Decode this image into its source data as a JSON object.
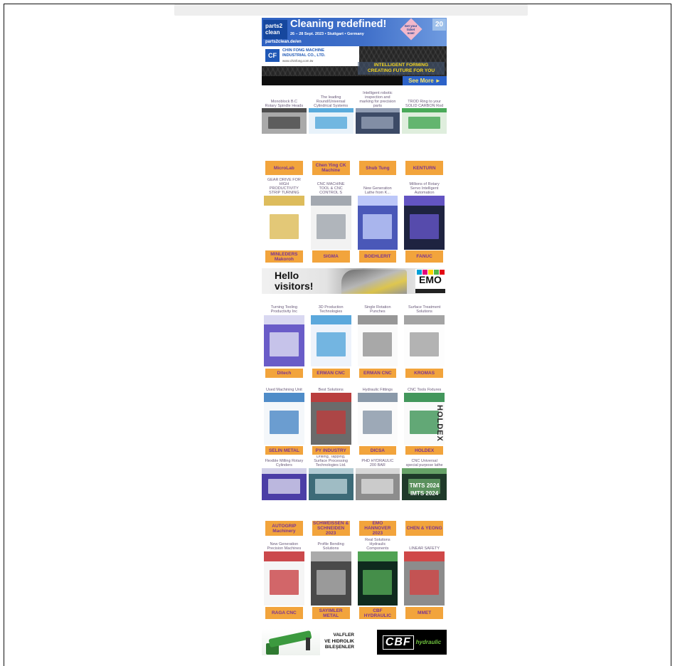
{
  "theme": {
    "frame": "#111111",
    "top_bar": "#eeeeee",
    "label_bg": "#f2a43c",
    "label_text": "#7b3593",
    "caption_text": "#6a5b7b",
    "parts2clean_blue": "#3f6fc9",
    "chinfong_yellow": "#f5d51f"
  },
  "top_banner": {
    "logo_line1": "parts2",
    "logo_line2": "clean",
    "headline": "Cleaning redefined!",
    "dates": "26 – 28 Sept. 2023 • Stuttgart • Germany",
    "url": "parts2clean.de/en",
    "ticket": "Get your ticket now!",
    "anniversary": "20"
  },
  "chinfong_banner": {
    "logo": "CF",
    "company_line1": "CHIN FONG MACHINE",
    "company_line2": "INDUSTRIAL CO., LTD.",
    "url": "www.chinfong.com.tw",
    "slogan_line1": "INTELLIGENT FORMING",
    "slogan_line2": "CREATING FUTURE FOR YOU",
    "cta": "See More ►"
  },
  "featured": [
    {
      "caption": "Monoblock B.C Rotary Spindle Heads",
      "image": {
        "bg": "#a9a9a9",
        "fg": "#444444"
      }
    },
    {
      "caption": "The leading Round/Universal Cylindrical Systems",
      "image": {
        "bg": "#e8f2fa",
        "fg": "#4aa3d8"
      }
    },
    {
      "caption": "Intelligent robotic inspection and marking for precision parts",
      "image": {
        "bg": "#3c4a66",
        "fg": "#9aa6bb"
      }
    },
    {
      "caption": "TROD Ring to your SOLID CARBON Rod",
      "image": {
        "bg": "#dfeedd",
        "fg": "#3aa24a"
      }
    }
  ],
  "blocks": [
    {
      "items": [
        {
          "top_label": "MicroLab",
          "caption": "GEAR DRIVE FOR HIGH PRODUCTIVITY STRIP TURNING",
          "label": "MINLEDERS Makoroh",
          "image": {
            "bg": "#ffffff",
            "fg": "#d9b54a"
          }
        },
        {
          "top_label": "Chen Ying CK Machine",
          "caption": "CNC MACHINE TOOL & CNC CONTROL S",
          "label": "SIGMA",
          "image": {
            "bg": "#f2f2f2",
            "fg": "#9aa0a8"
          }
        },
        {
          "top_label": "Shub Tung",
          "caption": "New Generation Lathe from K...",
          "label": "BOEHLERIT",
          "image": {
            "bg": "#4a58b8",
            "fg": "#c9d4ff"
          }
        },
        {
          "top_label": "KENTURN",
          "caption": "Millions of Rotary Servo Intelligent Automation",
          "label": "FANUC",
          "image": {
            "bg": "#1e2340",
            "fg": "#6a5ad0"
          }
        }
      ]
    },
    {
      "items": [
        {
          "caption": "Turning Tooling Productivity Inc",
          "label": "Ditech",
          "image": {
            "bg": "#6a5cc8",
            "fg": "#e6e6f5"
          }
        },
        {
          "caption": "3D Production Technologies",
          "label": "ERMAN CNC",
          "image": {
            "bg": "#eef3fb",
            "fg": "#4aa0d8"
          }
        },
        {
          "caption": "Single Rotation Punches",
          "label": "ERMAN CNC",
          "image": {
            "bg": "#fafafa",
            "fg": "#8c8c8c"
          }
        },
        {
          "caption": "Surface Treatment Solutions",
          "label": "KROMAS",
          "image": {
            "bg": "#fdfdfd",
            "fg": "#9a9a9a"
          }
        }
      ]
    },
    {
      "items": [
        {
          "caption": "Used Machining Unit",
          "label": "SELIN METAL",
          "image": {
            "bg": "#f4f7fa",
            "fg": "#3d7fc2"
          }
        },
        {
          "caption": "Best Solutions",
          "label": "PY INDUSTRY",
          "image": {
            "bg": "#6b6b6b",
            "fg": "#c23a3a"
          }
        },
        {
          "caption": "Hydraulic Fittings",
          "label": "DICSA",
          "image": {
            "bg": "#fbfbfb",
            "fg": "#7d8ea0"
          }
        },
        {
          "caption": "CNC Tools Fixtures",
          "label": "HOLDEX",
          "image": {
            "bg": "#fafafa",
            "fg": "#2f8c4a"
          },
          "image_texts": [
            "HOLDEX"
          ]
        }
      ]
    },
    {
      "items": [
        {
          "caption": "Flexible Milling Rotary Cylinders",
          "image": {
            "bg": "#4b3ea6",
            "fg": "#e0e0f0"
          }
        },
        {
          "caption": "Drilling, Tapping, Surface Processing Technologies Ltd.",
          "image": {
            "bg": "#3d6b78",
            "fg": "#c0d7de"
          }
        },
        {
          "caption": "PHD HYDRAULIC 200 BAR",
          "image": {
            "bg": "#8d8d8d",
            "fg": "#e0e0e0"
          }
        },
        {
          "caption": "CNC Universal special purpose lathe",
          "image": {
            "bg": "#1f3a2a",
            "fg": "#6fae6f"
          },
          "image_texts": [
            "TMTS 2024",
            "IMTS 2024"
          ]
        }
      ]
    },
    {
      "items": [
        {
          "top_label": "AUTOGRIP Machinery",
          "caption": "New Generation Precision Machines",
          "label": "RAGA CNC",
          "image": {
            "bg": "#f5f5f5",
            "fg": "#c6363a"
          }
        },
        {
          "top_label": "SCHWEISSEN & SCHNEIDEN 2023",
          "caption": "Profile Bending Solutions",
          "label": "SAYIMLER METAL",
          "image": {
            "bg": "#4a4a4a",
            "fg": "#b5b5b5"
          }
        },
        {
          "top_label": "EMO HANNOVER 2023",
          "caption": "Real Solutions Hydraulic Components",
          "label": "CBF HYDRAULIC",
          "image": {
            "bg": "#0f2a1e",
            "fg": "#58b05a"
          }
        },
        {
          "top_label": "CHEN & YEONG",
          "caption": "LINEAR SAFETY",
          "label": "MMET",
          "image": {
            "bg": "#8c8c8c",
            "fg": "#d64040"
          }
        }
      ]
    }
  ],
  "emo_banner": {
    "greeting_line1": "Hello",
    "greeting_line2": "visitors!",
    "logo": "EMO",
    "logo_colors": [
      "#00a0d8",
      "#e4007c",
      "#ffd400",
      "#53b848",
      "#e30613"
    ]
  },
  "bottom_banner": {
    "text_line1": "VALFLER",
    "text_line2": "VE HIDROLIK",
    "text_line3": "BILEŞENLER",
    "logo": "CBF",
    "logo_suffix": "hydraulic"
  }
}
